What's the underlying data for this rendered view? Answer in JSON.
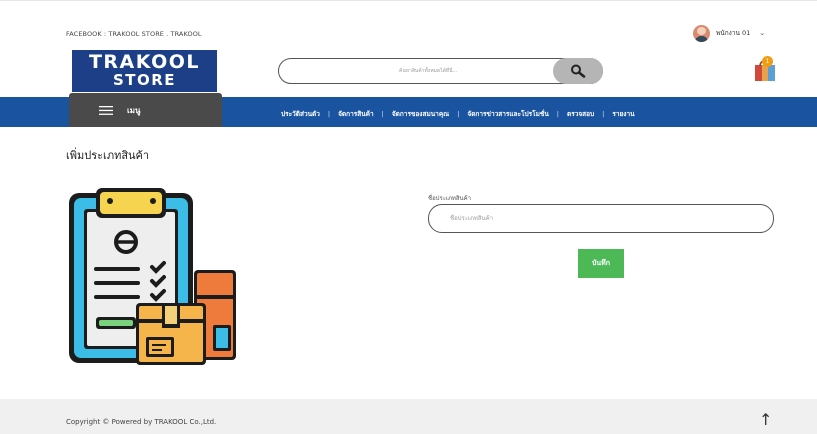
{
  "top": {
    "social_text": "FACEBOOK : TRAKOOL STORE . TRAKOOL",
    "user_name": "พนักงาน 01",
    "user_chevron": "⌄"
  },
  "brand": {
    "line1": "TRAKOOL",
    "line2": "STORE"
  },
  "search": {
    "placeholder": "ค้นหาสินค้าทั้งหมดได้ที่นี่..."
  },
  "cart": {
    "badge": "1"
  },
  "nav": {
    "menu_label": "เมนู",
    "items": [
      "ประวัติส่วนตัว",
      "จัดการสินค้า",
      "จัดการของสมนาคุณ",
      "จัดการข่าวสารและโปรโมชั่น",
      "ตรวจสอบ",
      "รายงาน"
    ],
    "separator": "|"
  },
  "main": {
    "title": "เพิ่มประเภทสินค้า",
    "field_label": "ชื่อประเภทสินค้า",
    "field_placeholder": "ชื่อประเภทสินค้า",
    "field_value": "",
    "save_label": "บันทึก"
  },
  "footer": {
    "copyright": "Copyright © Powered by TRAKOOL Co.,Ltd.",
    "up_arrow": "↑"
  },
  "colors": {
    "brand_blue": "#1d3f88",
    "nav_blue": "#1a54a0",
    "menu_gray": "#4a4a4a",
    "save_green": "#4db856",
    "footer_bg": "#f0f0f0"
  }
}
